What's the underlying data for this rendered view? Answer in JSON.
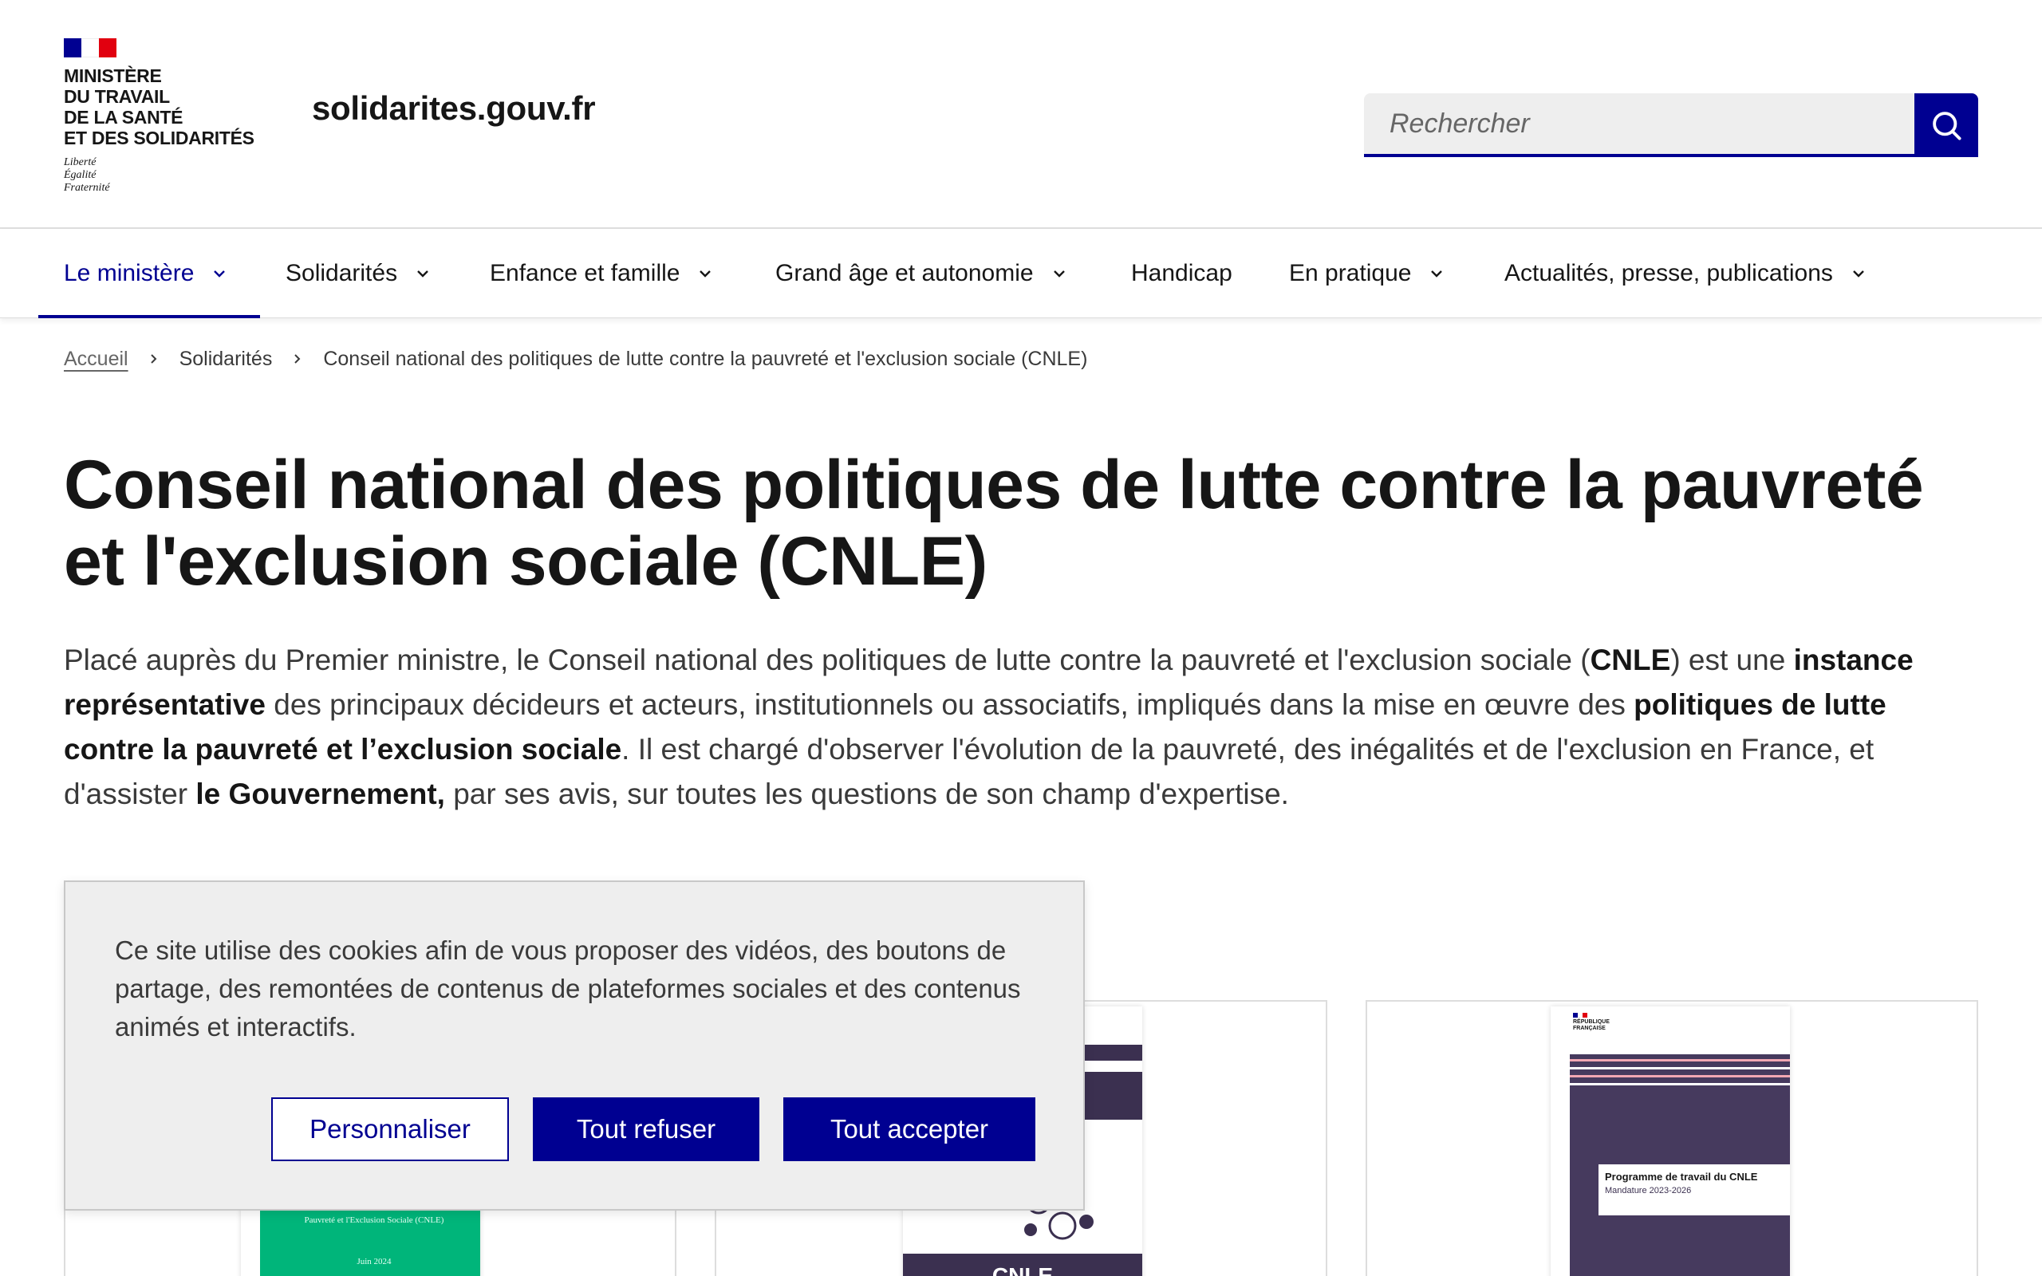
{
  "header": {
    "ministry_name": "MINISTÈRE DU TRAVAIL DE LA SANTÉ ET DES SOLIDARITÉS",
    "ministry_lines": [
      "MINISTÈRE",
      "DU TRAVAIL",
      "DE LA SANTÉ",
      "ET DES SOLIDARITÉS"
    ],
    "motto": [
      "Liberté",
      "Égalité",
      "Fraternité"
    ],
    "site_title": "solidarites.gouv.fr",
    "search_placeholder": "Rechercher",
    "search_icon": "search-icon"
  },
  "nav": {
    "items": [
      {
        "label": "Le ministère",
        "has_dropdown": true,
        "active": true
      },
      {
        "label": "Solidarités",
        "has_dropdown": true,
        "active": false
      },
      {
        "label": "Enfance et famille",
        "has_dropdown": true,
        "active": false
      },
      {
        "label": "Grand âge et autonomie",
        "has_dropdown": true,
        "active": false
      },
      {
        "label": "Handicap",
        "has_dropdown": false,
        "active": false
      },
      {
        "label": "En pratique",
        "has_dropdown": true,
        "active": false
      },
      {
        "label": "Actualités, presse, publications",
        "has_dropdown": true,
        "active": false
      }
    ]
  },
  "breadcrumb": {
    "items": [
      "Accueil",
      "Solidarités",
      "Conseil national des politiques de lutte contre la pauvreté et l'exclusion sociale (CNLE)"
    ]
  },
  "main": {
    "title": "Conseil national des politiques de lutte contre la pauvreté et l'exclusion sociale (CNLE)",
    "intro": {
      "t1": "Placé auprès du Premier ministre, le Conseil national des politiques de lutte contre la pauvreté et l'exclusion sociale (",
      "b1": "CNLE",
      "t2": ") est une ",
      "b2": "instance représentative",
      "t3": " des principaux décideurs et acteurs, institutionnels ou associatifs, impliqués dans la mise en œuvre des ",
      "b3": "politiques de lutte contre la pauvreté et l’exclusion sociale",
      "t4": ". Il est chargé d'observer l'évolution de la pauvreté, des inégalités et de l'exclusion en France, et d'assister ",
      "b4": "le Gouvernement,",
      "t5": " par ses avis, sur toutes les questions de son champ d'expertise."
    }
  },
  "cards": [
    {
      "doc_text_1": "Pauvreté et l'Exclusion Sociale (CNLE)",
      "doc_text_2": "Juin 2024"
    },
    {
      "doc_footer": "CNLE"
    },
    {
      "doc_box_title": "Programme de travail du CNLE",
      "doc_box_subtitle": "Mandature 2023-2026",
      "doc_logo": [
        "RÉPUBLIQUE",
        "FRANÇAISE"
      ]
    }
  ],
  "cookie_banner": {
    "text": "Ce site utilise des cookies afin de vous proposer des vidéos, des boutons de partage, des remontées de contenus de plateformes sociales et des contenus animés et interactifs.",
    "buttons": {
      "customize": "Personnaliser",
      "refuse": "Tout refuser",
      "accept": "Tout accepter"
    }
  },
  "colors": {
    "primary": "#000091",
    "marianne_red": "#e1000f",
    "text": "#161616",
    "text_muted": "#3a3a3a",
    "banner_bg": "#eeeeee"
  }
}
